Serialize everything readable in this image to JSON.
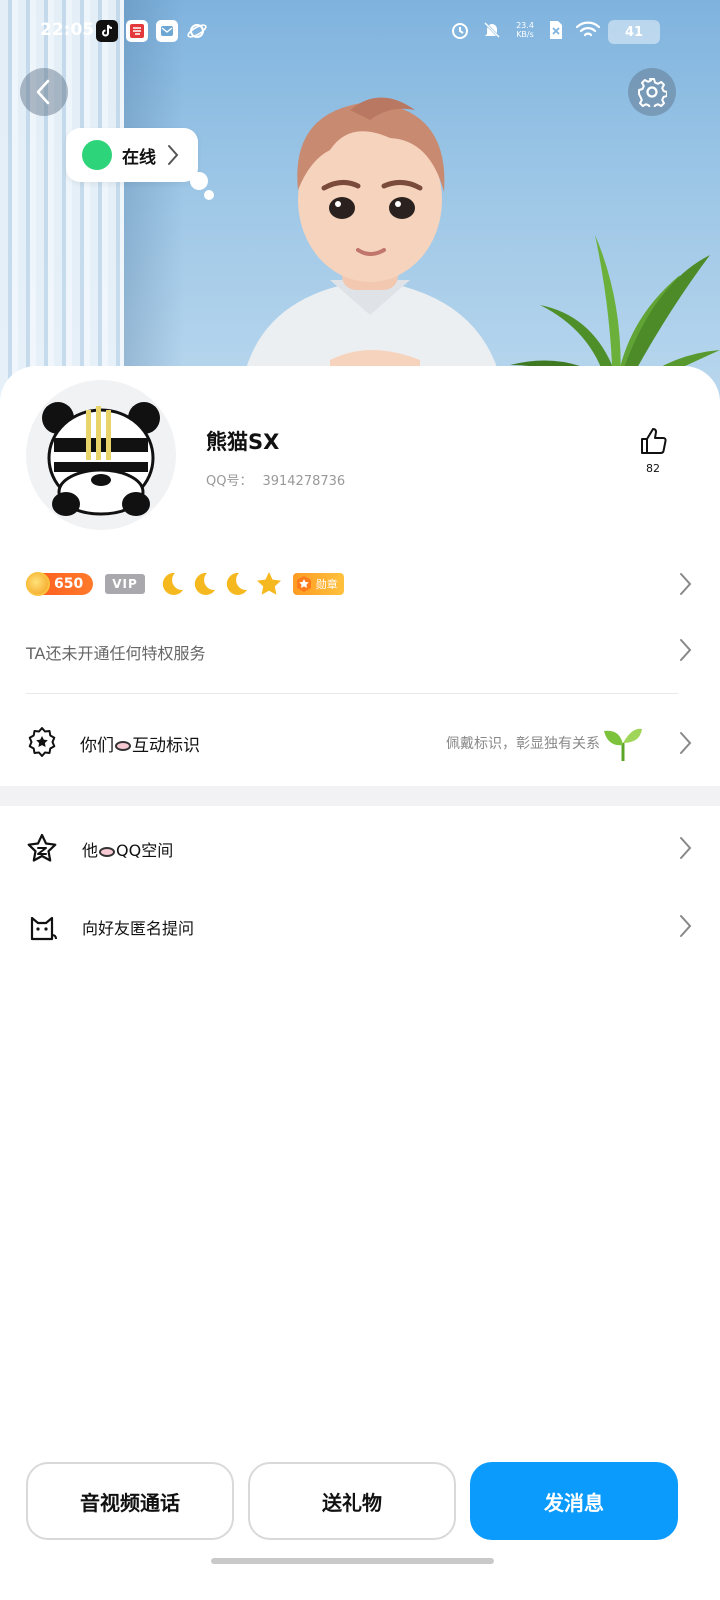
{
  "status_bar": {
    "time": "22:05",
    "network_speed_value": "23.4",
    "network_speed_unit": "KB/s",
    "battery": "41"
  },
  "hero": {
    "online_status": "在线"
  },
  "profile": {
    "nickname": "熊猫SX",
    "qq_label": "QQ号：",
    "qq_number": "3914278736",
    "likes": "82"
  },
  "badges": {
    "level": "650",
    "vip": "VIP",
    "medal": "勋章"
  },
  "privilege": {
    "text": "TA还未开通任何特权服务"
  },
  "interaction": {
    "label_prefix": "你们",
    "label_suffix": "互动标识",
    "hint": "佩戴标识，彰显独有关系"
  },
  "list": {
    "qzone_prefix": "他",
    "qzone_suffix": "QQ空间",
    "anonymous": "向好友匿名提问"
  },
  "actions": {
    "call": "音视频通话",
    "gift": "送礼物",
    "message": "发消息"
  },
  "colors": {
    "primary": "#0a9bfd",
    "online": "#2ed47a",
    "level_badge": "#ff5a1f"
  }
}
